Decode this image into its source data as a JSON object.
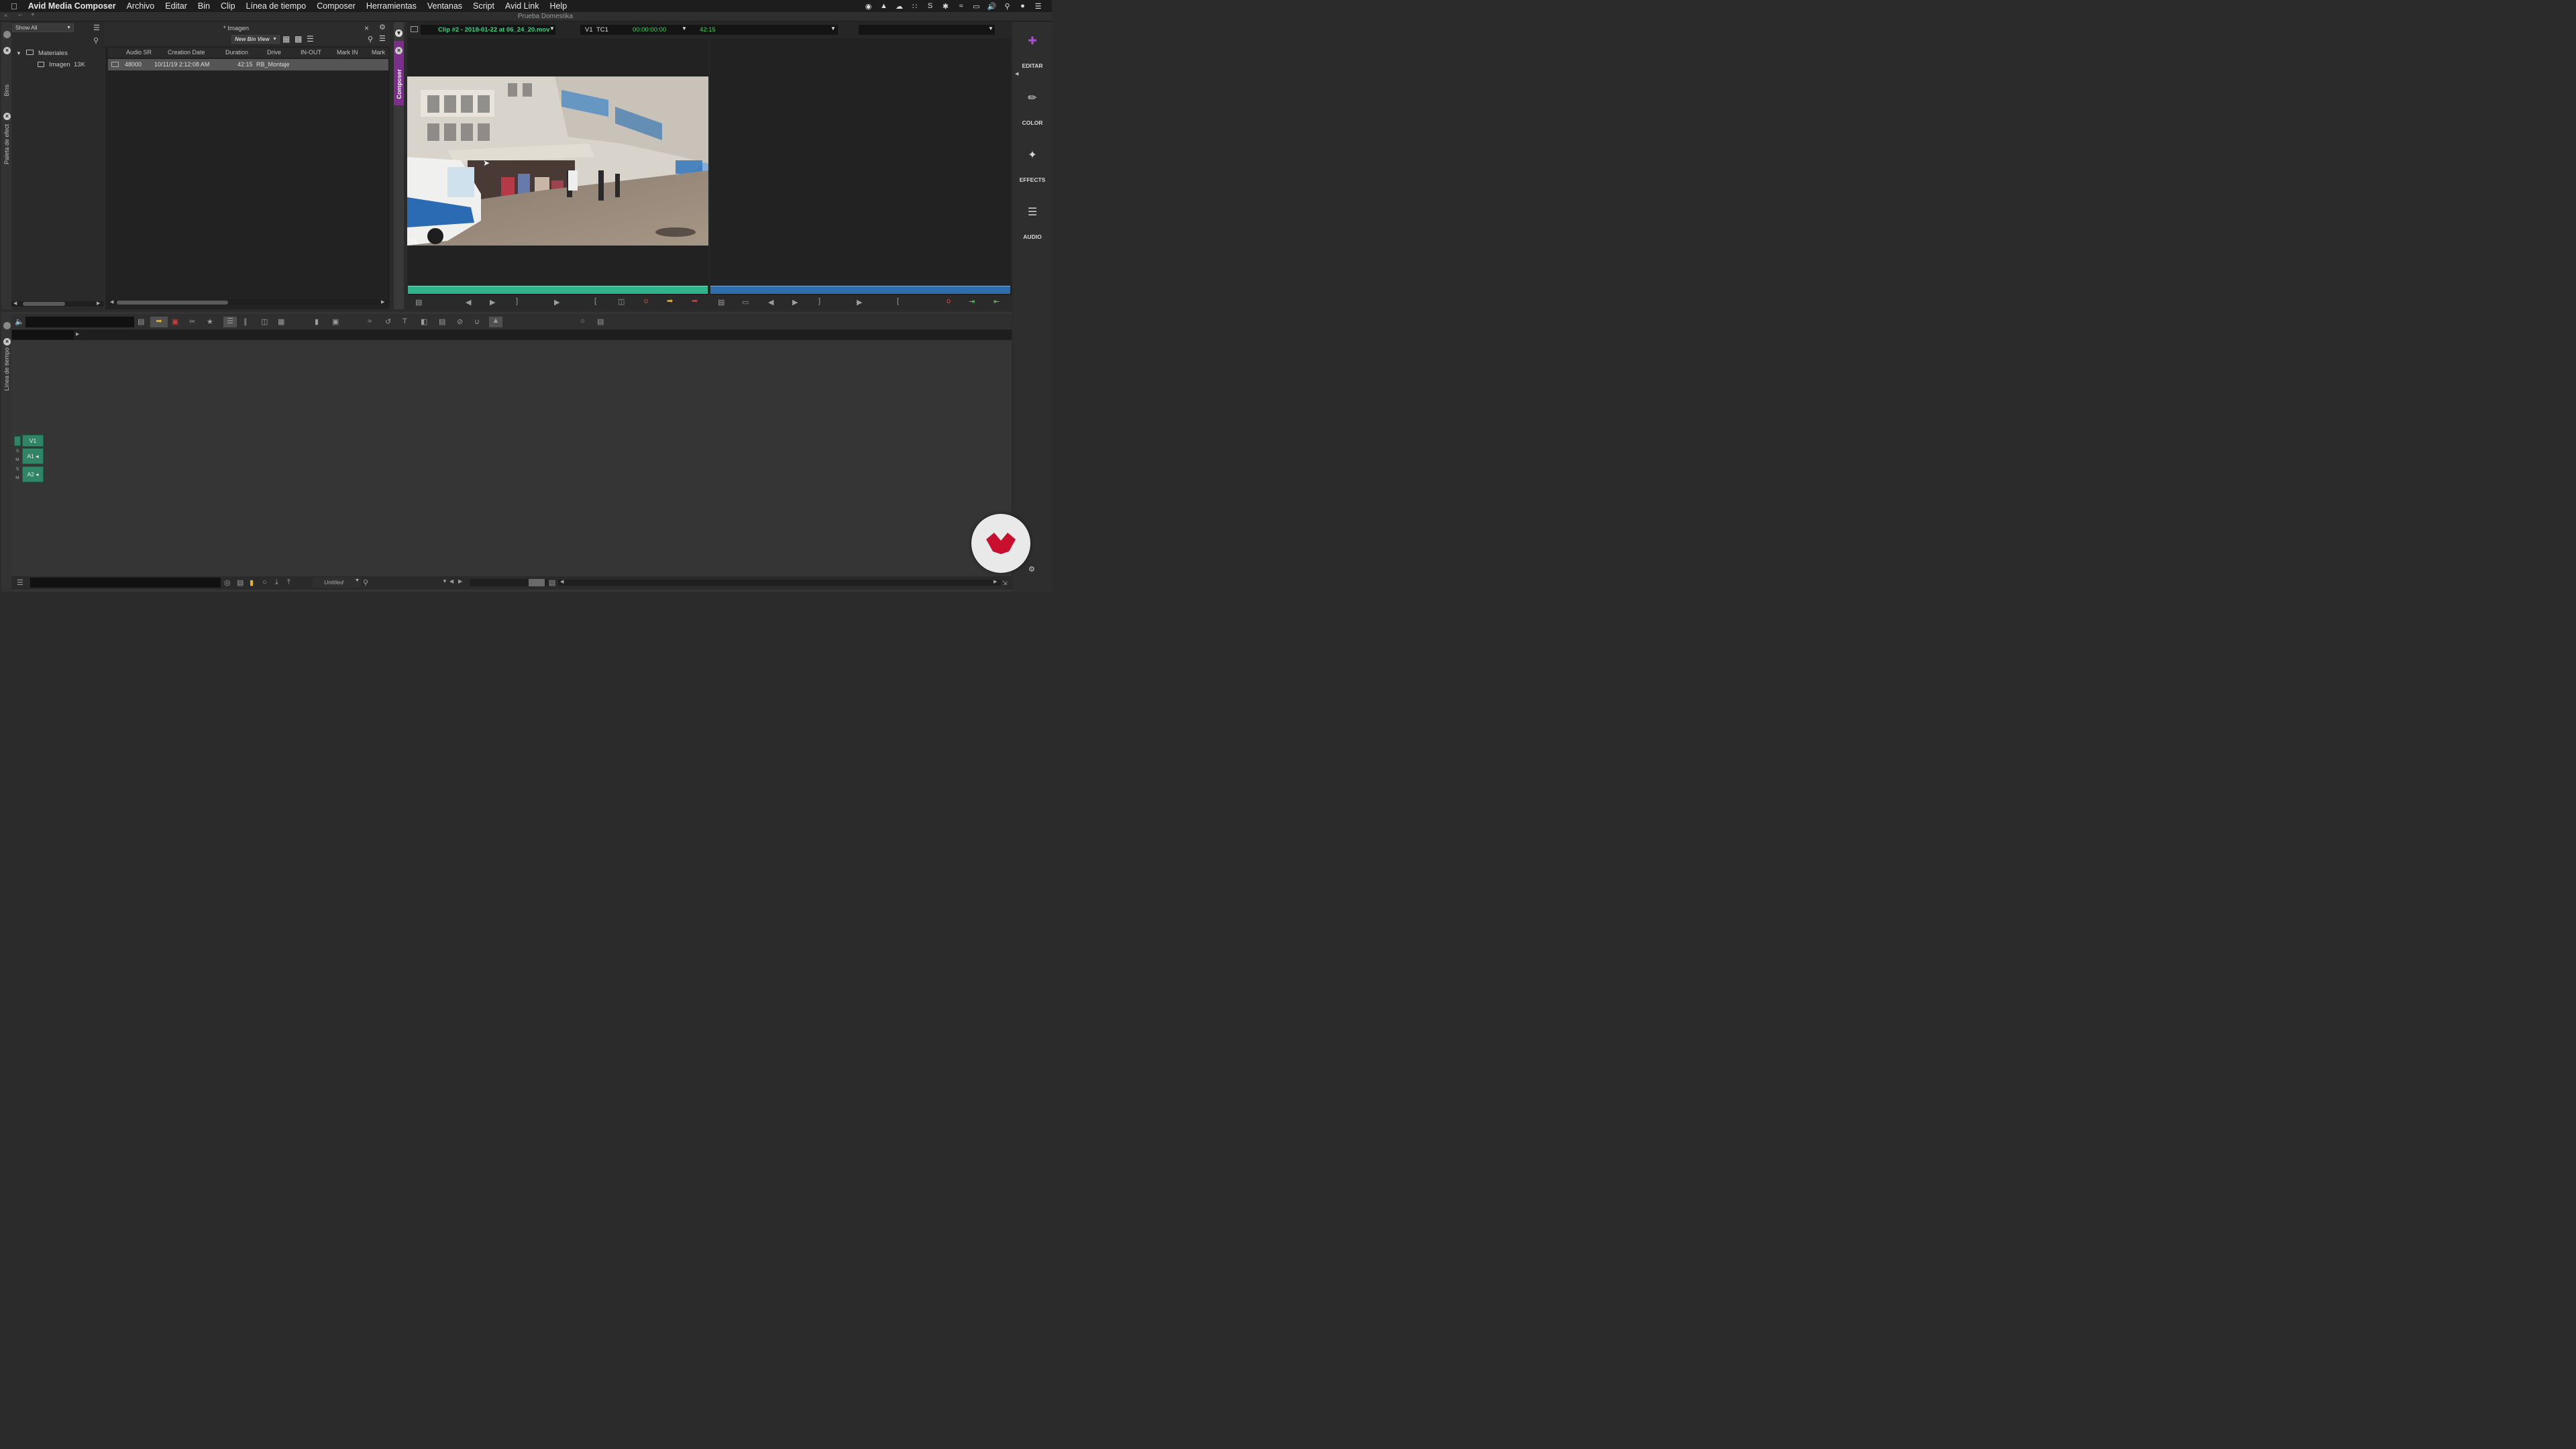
{
  "menubar": {
    "apple": "",
    "app_name": "Avid Media Composer",
    "items": [
      "Archivo",
      "Editar",
      "Bin",
      "Clip",
      "Línea de tiempo",
      "Composer",
      "Herramientas",
      "Ventanas",
      "Script",
      "Avid Link",
      "Help"
    ]
  },
  "project_title": "Prueba Domestika",
  "side_tabs": {
    "bins": "Bins",
    "effects": "Paleta de efect",
    "timeline": "Línea de tiempo",
    "composer": "Composer"
  },
  "bin_tree": {
    "filter": "Show All",
    "folder": "Materiales",
    "item": "Imagen",
    "item_size": "13K"
  },
  "bin": {
    "title": "* Imagen",
    "view": "New Bin View",
    "columns": [
      "Audio SR",
      "Creation Date",
      "Duration",
      "Drive",
      "IN-OUT",
      "Mark IN",
      "Mark"
    ],
    "rows": [
      {
        "audio_sr": "48000",
        "creation_date": "10/11/19 2:12:08 AM",
        "duration": "42:15",
        "drive": "RB_Montaje",
        "in_out": "",
        "mark_in": "",
        "mark": ""
      }
    ]
  },
  "composer": {
    "clip_name": "Clip #2 - 2018-01-22 at 06_24_20.mov",
    "track": "V1",
    "tc_label": "TC1",
    "timecode": "00:00:00:00",
    "duration": "42:15"
  },
  "right_rail": {
    "items": [
      "EDITAR",
      "COLOR",
      "EFFECTS",
      "AUDIO"
    ]
  },
  "timeline": {
    "tracks": [
      "V1",
      "A1",
      "A2"
    ],
    "sequence": "Untitled"
  },
  "colors": {
    "accent_green": "#2fb38a",
    "purple_tab": "#7b2f8a",
    "clip_green": "#36d080",
    "tc_green": "#38d45e",
    "brand_red": "#c8102e"
  }
}
